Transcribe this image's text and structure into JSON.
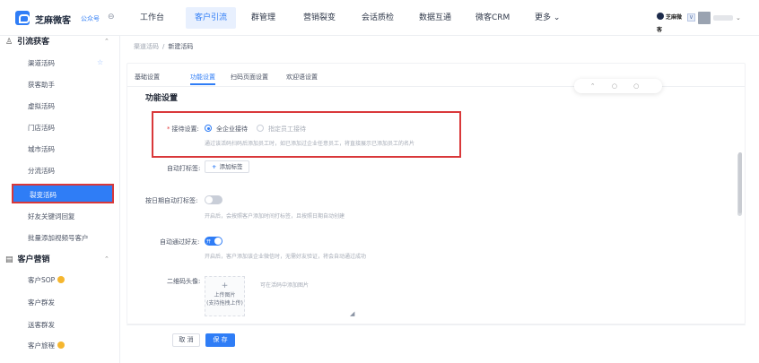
{
  "app": {
    "brand": "芝麻微客",
    "version": "公众号",
    "collapse_icon": "⊖"
  },
  "nav": {
    "items": [
      "工作台",
      "客户引流",
      "群管理",
      "营销裂变",
      "会话质检",
      "数据互通",
      "微客CRM",
      "更多 ⌄"
    ],
    "active_index": 1
  },
  "user": {
    "org": "芝麻微客",
    "vip": "V",
    "caret": "⌄"
  },
  "sidebar": {
    "group1": {
      "label": "引流获客",
      "icon": "person-plus-icon",
      "caret": "⌃"
    },
    "group1_items": [
      "渠道活码",
      "获客助手",
      "虚拟活码",
      "门店活码",
      "城市活码",
      "分流活码",
      "裂变活码",
      "好友关键词回复",
      "批量添加视频号客户"
    ],
    "active_item_index": 6,
    "pin_icon": "☆",
    "group2": {
      "label": "客户营销",
      "icon": "document-icon",
      "caret": "⌃"
    },
    "group2_items": [
      "客户SOP",
      "客户群发",
      "送客群发",
      "客户旅程"
    ]
  },
  "breadcrumb": {
    "parent": "渠道活码",
    "sep": "/",
    "current": "新建活码"
  },
  "tabs": [
    "基础设置",
    "功能设置",
    "扫码页面设置",
    "欢迎语设置"
  ],
  "active_tab_index": 1,
  "floating_widget": "⌃ ○ ○",
  "section_title": "功能设置",
  "form": {
    "reception": {
      "label": "接待设置:",
      "option1": "全企业接待",
      "option2": "指定员工接待",
      "hint": "通过该活码扫码后添加员工时，如已添加过企业任意员工，将直接展示已添加员工的名片"
    },
    "auto_tag": {
      "label": "自动打标签:",
      "button": "添加标签"
    },
    "customer_auto_tag": {
      "label": "按日期自动打标签:",
      "hint": "开启后，会按照客户添加时间打标签，且按照日期自动创建"
    },
    "auto_accept": {
      "label": "自动通过好友:",
      "switch_text": "开",
      "hint": "开启后，客户添加该企业微信时，无需好友验证，将会自动通过成功"
    },
    "qr_avatar": {
      "label": "二维码头像:",
      "upload_text1": "上传图片",
      "upload_text2": "(支持拖拽上传)",
      "hint": "可在活码中添加图片",
      "resize": "◢"
    }
  },
  "footer": {
    "cancel": "取 消",
    "save": "保 存"
  }
}
